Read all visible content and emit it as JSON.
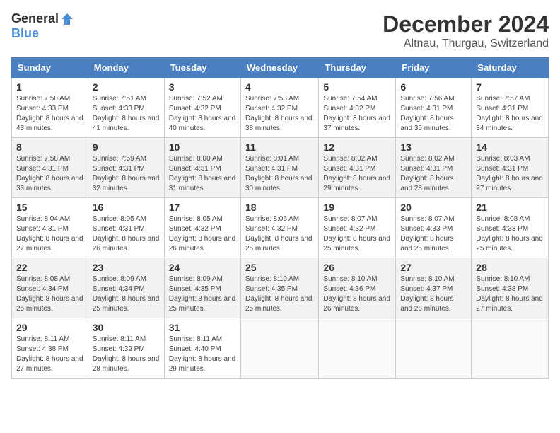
{
  "header": {
    "logo_general": "General",
    "logo_blue": "Blue",
    "month_title": "December 2024",
    "subtitle": "Altnau, Thurgau, Switzerland"
  },
  "weekdays": [
    "Sunday",
    "Monday",
    "Tuesday",
    "Wednesday",
    "Thursday",
    "Friday",
    "Saturday"
  ],
  "weeks": [
    [
      {
        "day": "1",
        "sunrise": "Sunrise: 7:50 AM",
        "sunset": "Sunset: 4:33 PM",
        "daylight": "Daylight: 8 hours and 43 minutes."
      },
      {
        "day": "2",
        "sunrise": "Sunrise: 7:51 AM",
        "sunset": "Sunset: 4:33 PM",
        "daylight": "Daylight: 8 hours and 41 minutes."
      },
      {
        "day": "3",
        "sunrise": "Sunrise: 7:52 AM",
        "sunset": "Sunset: 4:32 PM",
        "daylight": "Daylight: 8 hours and 40 minutes."
      },
      {
        "day": "4",
        "sunrise": "Sunrise: 7:53 AM",
        "sunset": "Sunset: 4:32 PM",
        "daylight": "Daylight: 8 hours and 38 minutes."
      },
      {
        "day": "5",
        "sunrise": "Sunrise: 7:54 AM",
        "sunset": "Sunset: 4:32 PM",
        "daylight": "Daylight: 8 hours and 37 minutes."
      },
      {
        "day": "6",
        "sunrise": "Sunrise: 7:56 AM",
        "sunset": "Sunset: 4:31 PM",
        "daylight": "Daylight: 8 hours and 35 minutes."
      },
      {
        "day": "7",
        "sunrise": "Sunrise: 7:57 AM",
        "sunset": "Sunset: 4:31 PM",
        "daylight": "Daylight: 8 hours and 34 minutes."
      }
    ],
    [
      {
        "day": "8",
        "sunrise": "Sunrise: 7:58 AM",
        "sunset": "Sunset: 4:31 PM",
        "daylight": "Daylight: 8 hours and 33 minutes."
      },
      {
        "day": "9",
        "sunrise": "Sunrise: 7:59 AM",
        "sunset": "Sunset: 4:31 PM",
        "daylight": "Daylight: 8 hours and 32 minutes."
      },
      {
        "day": "10",
        "sunrise": "Sunrise: 8:00 AM",
        "sunset": "Sunset: 4:31 PM",
        "daylight": "Daylight: 8 hours and 31 minutes."
      },
      {
        "day": "11",
        "sunrise": "Sunrise: 8:01 AM",
        "sunset": "Sunset: 4:31 PM",
        "daylight": "Daylight: 8 hours and 30 minutes."
      },
      {
        "day": "12",
        "sunrise": "Sunrise: 8:02 AM",
        "sunset": "Sunset: 4:31 PM",
        "daylight": "Daylight: 8 hours and 29 minutes."
      },
      {
        "day": "13",
        "sunrise": "Sunrise: 8:02 AM",
        "sunset": "Sunset: 4:31 PM",
        "daylight": "Daylight: 8 hours and 28 minutes."
      },
      {
        "day": "14",
        "sunrise": "Sunrise: 8:03 AM",
        "sunset": "Sunset: 4:31 PM",
        "daylight": "Daylight: 8 hours and 27 minutes."
      }
    ],
    [
      {
        "day": "15",
        "sunrise": "Sunrise: 8:04 AM",
        "sunset": "Sunset: 4:31 PM",
        "daylight": "Daylight: 8 hours and 27 minutes."
      },
      {
        "day": "16",
        "sunrise": "Sunrise: 8:05 AM",
        "sunset": "Sunset: 4:31 PM",
        "daylight": "Daylight: 8 hours and 26 minutes."
      },
      {
        "day": "17",
        "sunrise": "Sunrise: 8:05 AM",
        "sunset": "Sunset: 4:32 PM",
        "daylight": "Daylight: 8 hours and 26 minutes."
      },
      {
        "day": "18",
        "sunrise": "Sunrise: 8:06 AM",
        "sunset": "Sunset: 4:32 PM",
        "daylight": "Daylight: 8 hours and 25 minutes."
      },
      {
        "day": "19",
        "sunrise": "Sunrise: 8:07 AM",
        "sunset": "Sunset: 4:32 PM",
        "daylight": "Daylight: 8 hours and 25 minutes."
      },
      {
        "day": "20",
        "sunrise": "Sunrise: 8:07 AM",
        "sunset": "Sunset: 4:33 PM",
        "daylight": "Daylight: 8 hours and 25 minutes."
      },
      {
        "day": "21",
        "sunrise": "Sunrise: 8:08 AM",
        "sunset": "Sunset: 4:33 PM",
        "daylight": "Daylight: 8 hours and 25 minutes."
      }
    ],
    [
      {
        "day": "22",
        "sunrise": "Sunrise: 8:08 AM",
        "sunset": "Sunset: 4:34 PM",
        "daylight": "Daylight: 8 hours and 25 minutes."
      },
      {
        "day": "23",
        "sunrise": "Sunrise: 8:09 AM",
        "sunset": "Sunset: 4:34 PM",
        "daylight": "Daylight: 8 hours and 25 minutes."
      },
      {
        "day": "24",
        "sunrise": "Sunrise: 8:09 AM",
        "sunset": "Sunset: 4:35 PM",
        "daylight": "Daylight: 8 hours and 25 minutes."
      },
      {
        "day": "25",
        "sunrise": "Sunrise: 8:10 AM",
        "sunset": "Sunset: 4:35 PM",
        "daylight": "Daylight: 8 hours and 25 minutes."
      },
      {
        "day": "26",
        "sunrise": "Sunrise: 8:10 AM",
        "sunset": "Sunset: 4:36 PM",
        "daylight": "Daylight: 8 hours and 26 minutes."
      },
      {
        "day": "27",
        "sunrise": "Sunrise: 8:10 AM",
        "sunset": "Sunset: 4:37 PM",
        "daylight": "Daylight: 8 hours and 26 minutes."
      },
      {
        "day": "28",
        "sunrise": "Sunrise: 8:10 AM",
        "sunset": "Sunset: 4:38 PM",
        "daylight": "Daylight: 8 hours and 27 minutes."
      }
    ],
    [
      {
        "day": "29",
        "sunrise": "Sunrise: 8:11 AM",
        "sunset": "Sunset: 4:38 PM",
        "daylight": "Daylight: 8 hours and 27 minutes."
      },
      {
        "day": "30",
        "sunrise": "Sunrise: 8:11 AM",
        "sunset": "Sunset: 4:39 PM",
        "daylight": "Daylight: 8 hours and 28 minutes."
      },
      {
        "day": "31",
        "sunrise": "Sunrise: 8:11 AM",
        "sunset": "Sunset: 4:40 PM",
        "daylight": "Daylight: 8 hours and 29 minutes."
      },
      null,
      null,
      null,
      null
    ]
  ]
}
